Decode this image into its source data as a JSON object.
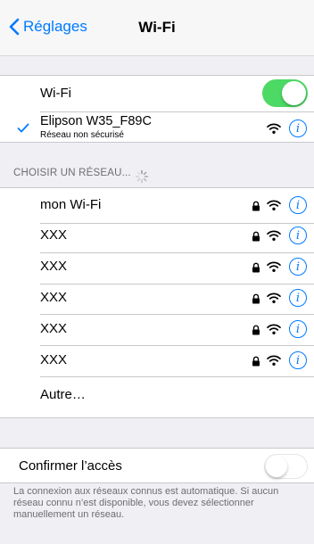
{
  "navbar": {
    "back_label": "Réglages",
    "title": "Wi-Fi"
  },
  "wifi_toggle": {
    "label": "Wi-Fi",
    "state": "on"
  },
  "connected": {
    "name": "Elipson W35_F89C",
    "subtitle": "Réseau non sécurisé"
  },
  "section_header": "CHOISIR UN RÉSEAU...",
  "networks": [
    {
      "name": "mon Wi-Fi",
      "secured": true
    },
    {
      "name": "XXX",
      "secured": true
    },
    {
      "name": "XXX",
      "secured": true
    },
    {
      "name": "XXX",
      "secured": true
    },
    {
      "name": "XXX",
      "secured": true
    },
    {
      "name": "XXX",
      "secured": true
    }
  ],
  "other_label": "Autre…",
  "ask_join": {
    "label": "Confirmer l’accès",
    "state": "off"
  },
  "footer_text": "La connexion aux réseaux connus est automatique. Si aucun réseau connu n’est disponible, vous devez sélectionner manuellement un réseau.",
  "colors": {
    "accent": "#007aff",
    "toggle_on": "#4cd964",
    "background": "#efeff4"
  },
  "icons": {
    "back": "chevron-left-icon",
    "check": "checkmark-icon",
    "lock": "lock-icon",
    "wifi": "wifi-icon",
    "info": "info-icon",
    "spinner": "spinner-icon"
  }
}
